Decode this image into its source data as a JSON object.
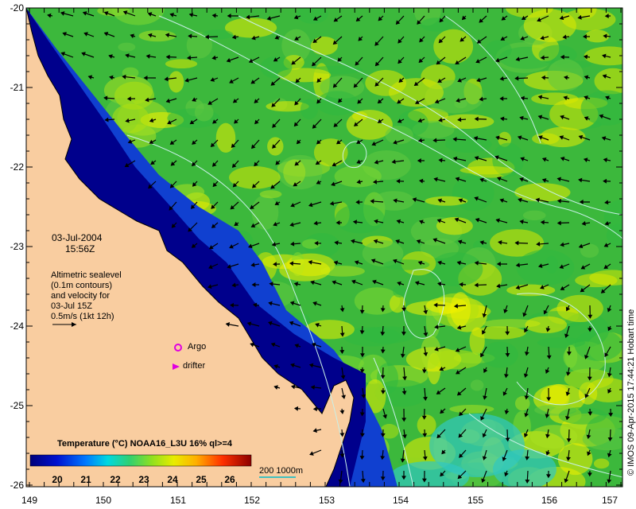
{
  "map": {
    "date": "03-Jul-2004",
    "time": "15:56Z",
    "legend_lines": [
      "Altimetric sealevel",
      "(0.1m contours)",
      "and velocity for",
      "03-Jul 15Z",
      "0.5m/s (1kt 12h)"
    ],
    "argo_label": "Argo",
    "drifter_label": "drifter",
    "colorbar_title": "Temperature (°C) NOAA16_L3U 16% ql>=4",
    "colorbar_ticks": [
      "20",
      "21",
      "22",
      "23",
      "24",
      "25",
      "26"
    ],
    "scale_label": "200  1000m",
    "credit": "© IMOS 09-Apr-2015 17:44:21 Hobart time",
    "lat_ticks": [
      "-20",
      "-21",
      "-22",
      "-23",
      "-24",
      "-25",
      "-26"
    ],
    "lon_ticks": [
      "149",
      "150",
      "151",
      "152",
      "153",
      "154",
      "155",
      "156",
      "157"
    ],
    "colors": {
      "land": "#f9cda0",
      "cold": "#00008c",
      "warm": "#e0ec00",
      "argo": "#e000e0",
      "contour": "#c8f0e8"
    }
  }
}
